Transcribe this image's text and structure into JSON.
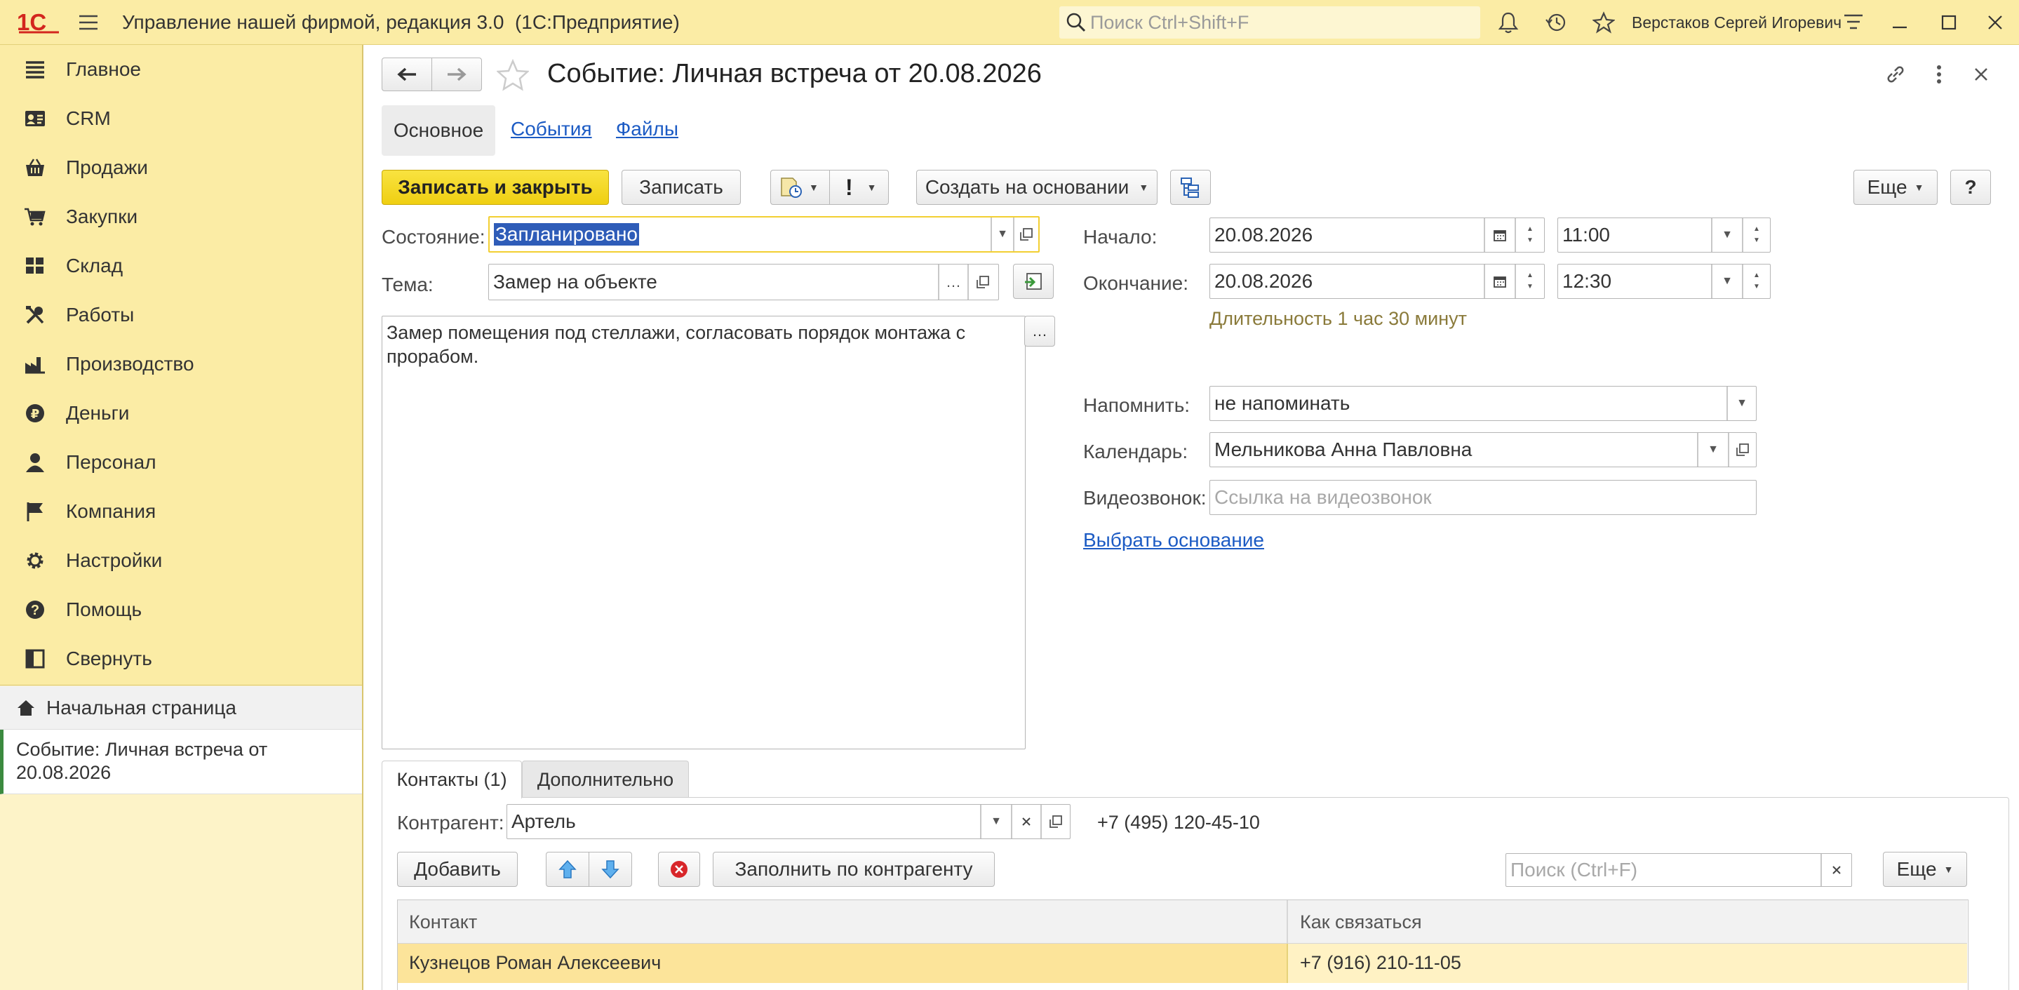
{
  "window": {
    "title": "Управление нашей фирмой, редакция 3.0  (1С:Предприятие)",
    "search_placeholder": "Поиск Ctrl+Shift+F",
    "user": "Верстаков Сергей Игоревич"
  },
  "sidebar": {
    "items": [
      {
        "label": "Главное",
        "icon": "list-icon"
      },
      {
        "label": "CRM",
        "icon": "contacts-icon"
      },
      {
        "label": "Продажи",
        "icon": "basket-icon"
      },
      {
        "label": "Закупки",
        "icon": "cart-icon"
      },
      {
        "label": "Склад",
        "icon": "warehouse-icon"
      },
      {
        "label": "Работы",
        "icon": "tools-icon"
      },
      {
        "label": "Производство",
        "icon": "factory-icon"
      },
      {
        "label": "Деньги",
        "icon": "ruble-icon"
      },
      {
        "label": "Персонал",
        "icon": "person-icon"
      },
      {
        "label": "Компания",
        "icon": "flag-icon"
      },
      {
        "label": "Настройки",
        "icon": "gear-icon"
      },
      {
        "label": "Помощь",
        "icon": "help-icon"
      },
      {
        "label": "Свернуть",
        "icon": "collapse-icon"
      }
    ],
    "home": "Начальная страница",
    "open_document": "Событие: Личная встреча от 20.08.2026"
  },
  "form": {
    "title": "Событие: Личная встреча от 20.08.2026",
    "tabs": [
      "Основное",
      "События",
      "Файлы"
    ],
    "toolbar": {
      "save_close": "Записать и закрыть",
      "save": "Записать",
      "create_based": "Создать на основании",
      "more": "Еще",
      "help": "?"
    },
    "state_label": "Состояние:",
    "state_value": "Запланировано",
    "topic_label": "Тема:",
    "topic_value": "Замер на объекте",
    "description": "Замер помещения под стеллажи, согласовать порядок монтажа с прорабом.",
    "start_label": "Начало:",
    "start_date": "20.08.2026",
    "start_time": "11:00",
    "end_label": "Окончание:",
    "end_date": "20.08.2026",
    "end_time": "12:30",
    "duration": "Длительность 1 час 30 минут",
    "remind_label": "Напомнить:",
    "remind_value": "не напоминать",
    "calendar_label": "Календарь:",
    "calendar_value": "Мельникова Анна Павловна",
    "video_label": "Видеозвонок:",
    "video_placeholder": "Ссылка на видеозвонок",
    "choose_basis": "Выбрать основание"
  },
  "bottom": {
    "tabs": [
      "Контакты (1)",
      "Дополнительно"
    ],
    "counterparty_label": "Контрагент:",
    "counterparty_value": "Артель",
    "counterparty_phone": "+7 (495) 120-45-10",
    "add": "Добавить",
    "fill": "Заполнить по контрагенту",
    "search_placeholder": "Поиск (Ctrl+F)",
    "more": "Еще",
    "columns": [
      "Контакт",
      "Как связаться"
    ],
    "rows": [
      {
        "contact": "Кузнецов Роман Алексеевич",
        "how": "+7 (916) 210-11-05"
      }
    ]
  },
  "colors": {
    "accent_yellow": "#fbeca5",
    "primary_button": "#f4d71c",
    "selected_row": "#fce49a",
    "link_blue": "#1c5bc4",
    "duration_text": "#8a7a3a"
  }
}
